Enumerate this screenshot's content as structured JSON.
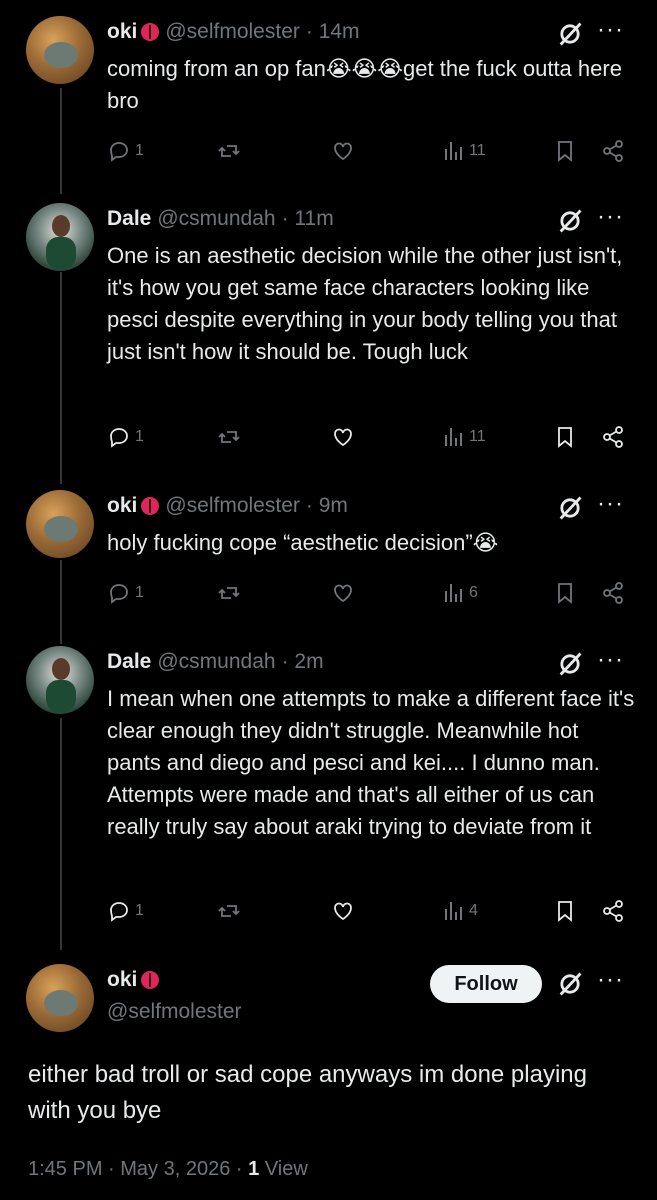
{
  "tweets": [
    {
      "name": "oki",
      "handle": "@selfmolester",
      "time": "· 14m",
      "text": "coming from an op fan😭😭😭get the fuck outta here bro",
      "replies": "1",
      "views": "11"
    },
    {
      "name": "Dale",
      "handle": "@csmundah",
      "time": "· 11m",
      "text": "One is an aesthetic decision while the other just isn't, it's how you get same face characters looking like pesci despite everything in your body telling you that just isn't how it should be. Tough luck",
      "replies": "1",
      "views": "11"
    },
    {
      "name": "oki",
      "handle": "@selfmolester",
      "time": "· 9m",
      "text": "holy fucking cope “aesthetic decision”😭",
      "replies": "1",
      "views": "6"
    },
    {
      "name": "Dale",
      "handle": "@csmundah",
      "time": "· 2m",
      "text": "I mean when one attempts to make a different face it's clear enough they didn't struggle. Meanwhile hot pants and diego and pesci and kei.... I dunno man. Attempts were made and that's all either of us can really truly say about araki trying to deviate from it",
      "replies": "1",
      "views": "4"
    }
  ],
  "focus": {
    "name": "oki",
    "handle": "@selfmolester",
    "follow_label": "Follow",
    "text": "either bad troll or sad cope anyways im done playing with you bye",
    "time": "1:45 PM",
    "date": "May 3, 2026",
    "views_count": "1",
    "views_label": "View"
  },
  "icons": {
    "reply": "reply-icon",
    "retweet": "retweet-icon",
    "like": "heart-icon",
    "views": "views-icon",
    "bookmark": "bookmark-icon",
    "share": "share-icon",
    "grok": "grok-icon",
    "more": "more-icon"
  },
  "colors": {
    "background": "#000000",
    "text": "#e7e9ea",
    "muted": "#71767b",
    "follow_bg": "#eff3f4"
  }
}
